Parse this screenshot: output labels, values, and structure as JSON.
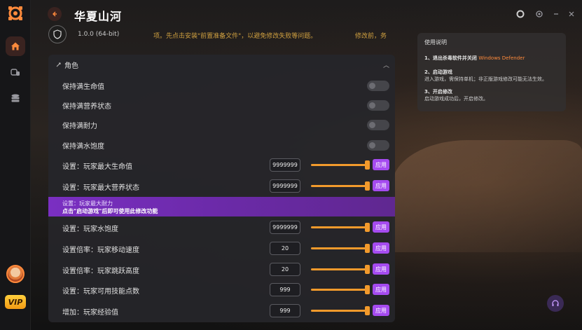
{
  "app": {
    "title": "华夏山河",
    "accent": "#ff8a3c",
    "apply_color": "#a54bf0"
  },
  "info": {
    "version": "1.0.0 (64-bit)",
    "warning": "项。先点击安装\"前置准备文件\"，以避免修改失败等问题。",
    "warning_tail": "修改前，务"
  },
  "guide": {
    "title": "使用说明",
    "step1_title": "1、退出杀毒软件并关闭",
    "step1_highlight": "Windows Defender",
    "step2_title": "2、启动游戏",
    "step2_desc": "进入游戏，需保持单机；非正版游戏修改可能无法生效。",
    "step3_title": "3、开启修改",
    "step3_desc": "启动游戏成功后，开启修改。"
  },
  "panel": {
    "section_title": "角色",
    "toggles": [
      {
        "label": "保持满生命值",
        "on": false
      },
      {
        "label": "保持满营养状态",
        "on": false
      },
      {
        "label": "保持满耐力",
        "on": false
      },
      {
        "label": "保持满水饱度",
        "on": false
      }
    ],
    "apply_label": "应用",
    "value_rows": [
      {
        "label": "设置：玩家最大生命值",
        "value": "9999999"
      },
      {
        "label": "设置：玩家最大营养状态",
        "value": "9999999"
      },
      {
        "label": "设置：玩家水饱度",
        "value": "9999999"
      },
      {
        "label": "设置倍率：玩家移动速度",
        "value": "20"
      },
      {
        "label": "设置倍率：玩家跳跃高度",
        "value": "20"
      },
      {
        "label": "设置：玩家可用技能点数",
        "value": "999"
      },
      {
        "label": "增加：玩家经验值",
        "value": "999"
      }
    ],
    "locked_row": {
      "label": "设置：玩家最大耐力",
      "notice": "点击\"启动游戏\"后即可使用此修改功能"
    }
  },
  "vip_label": "VIP"
}
